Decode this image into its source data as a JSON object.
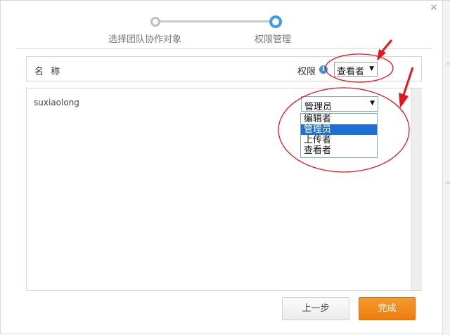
{
  "colors": {
    "accent": "#3d9be9",
    "selected_option": "#1e6fd7",
    "primary_button": "#ec7d0b",
    "annotation": "#e0191f"
  },
  "steps": [
    {
      "label": "选择团队协作对象",
      "state": "done"
    },
    {
      "label": "权限管理",
      "state": "active"
    }
  ],
  "header": {
    "name_label": "名 称",
    "permission_label": "权限",
    "info_icon": "info-icon",
    "default_permission": "查看者"
  },
  "members": [
    {
      "name": "suxiaolong",
      "permission": "管理员"
    }
  ],
  "permission_dropdown": {
    "options": [
      "编辑者",
      "管理员",
      "上传者",
      "查看者"
    ],
    "highlighted": "管理员"
  },
  "buttons": {
    "prev": "上一步",
    "done": "完成"
  },
  "icons": {
    "close": "close-icon",
    "dropdown": "dropdown-arrow-icon"
  }
}
